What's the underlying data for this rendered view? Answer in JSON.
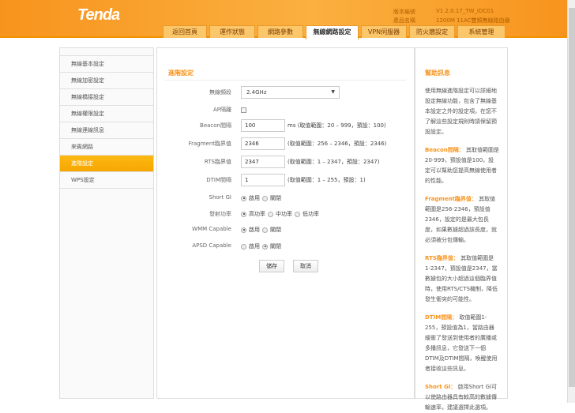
{
  "header": {
    "logo": "Tenda",
    "version_label": "版本編號",
    "version": "V1.2.0.17_TW_IDC01",
    "product_label": "產品名稱",
    "product": "1200M 11AC雙頻無線路由器"
  },
  "tabs": [
    "返回首頁",
    "運作狀態",
    "網路參數",
    "無線網路設定",
    "VPN伺服器",
    "防火牆設定",
    "系統管理"
  ],
  "active_tab": 3,
  "sidebar": [
    "無線基本設定",
    "無線加密設定",
    "無線橋接設定",
    "無線權限設定",
    "無線連線訊息",
    "來賓網路",
    "進階設定",
    "WPS設定"
  ],
  "active_sidebar": 6,
  "form": {
    "title": "進階設定",
    "band_label": "無線頻段",
    "band_value": "2.4GHz",
    "ap_isolation_label": "AP隔離",
    "beacon_label": "Beacon間隔",
    "beacon_value": "100",
    "beacon_hint": "ms (取值範圍：20 – 999，預設：100)",
    "fragment_label": "Fragment臨界值",
    "fragment_value": "2346",
    "fragment_hint": "(取值範圍：256 – 2346，預設：2346)",
    "rts_label": "RTS臨界值",
    "rts_value": "2347",
    "rts_hint": "(取值範圍：1 – 2347，預設：2347)",
    "dtim_label": "DTIM間隔",
    "dtim_value": "1",
    "dtim_hint": "(取值範圍：1 – 255，預設：1)",
    "shortgi_label": "Short GI",
    "power_label": "發射功率",
    "wmm_label": "WMM Capable",
    "apsd_label": "APSD Capable",
    "enable": "啟用",
    "disable": "關閉",
    "power_high": "高功率",
    "power_mid": "中功率",
    "power_low": "低功率",
    "save": "儲存",
    "cancel": "取消"
  },
  "help": {
    "title": "幫助訊息",
    "intro": "使用無線進階設定可以詳細地設定無線功能，包含了無線基本設定之外的設定項，在您不了解這些設定規則時請保留預設設定。",
    "beacon_term": "Beacon間隔：",
    "beacon_text": " 其取值範圍是20-999，預設值是100，設定可以幫助您提高無線使用者的性能。",
    "fragment_term": "Fragment臨界值：",
    "fragment_text": " 其取值範圍是256-2346，預設值2346，設定的是最大包長度，如果數據超過該長度，就必須被分包傳輸。",
    "rts_term": "RTS臨界值：",
    "rts_text": " 其取值範圍是1-2347，預設值是2347，當數據包的大小超過這個臨界值時，使用RTS/CTS機制，降低發生衝突的可能性。",
    "dtim_term": "DTIM間隔：",
    "dtim_text": " 取值範圍1-255，預設值為1，當路由器緩衝了發送到使用者的廣播或多播訊息，它發送下一個DTIM及DTIM間隔，喚醒使用者接收這些訊息。",
    "shortgi_term": "Short GI：",
    "shortgi_text": " 啟用Short GI可以使路由器具有較高的數據傳輸速率，建議選擇此選項。"
  }
}
